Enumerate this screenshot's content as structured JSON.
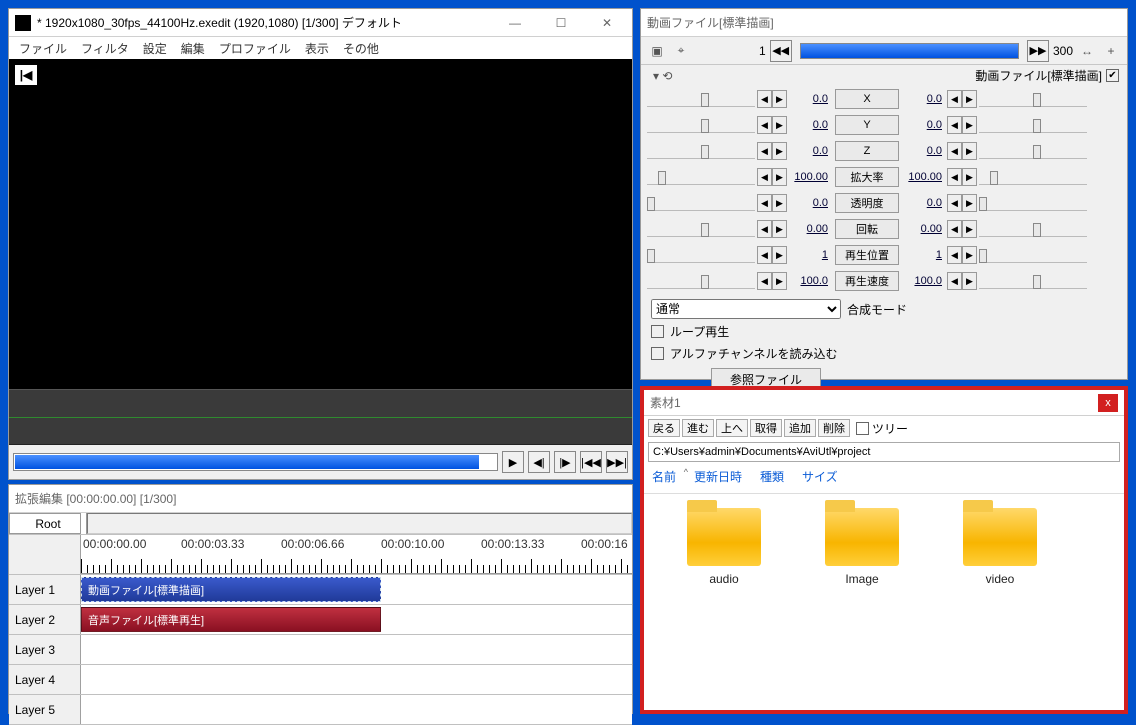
{
  "main": {
    "title": "* 1920x1080_30fps_44100Hz.exedit (1920,1080)  [1/300]  デフォルト",
    "menus": [
      "ファイル",
      "フィルタ",
      "設定",
      "編集",
      "プロファイル",
      "表示",
      "その他"
    ],
    "first_frame_icon": "|◀",
    "transport": [
      "▶",
      "◀|",
      "|▶",
      "|◀◀",
      "▶▶|"
    ]
  },
  "timeline": {
    "title": "拡張編集 [00:00:00.00] [1/300]",
    "root_label": "Root",
    "times": [
      "00:00:00.00",
      "00:00:03.33",
      "00:00:06.66",
      "00:00:10.00",
      "00:00:13.33",
      "00:00:16"
    ],
    "layers": [
      "Layer 1",
      "Layer 2",
      "Layer 3",
      "Layer 4",
      "Layer 5"
    ],
    "clip_video": "動画ファイル[標準描画]",
    "clip_audio": "音声ファイル[標準再生]"
  },
  "props": {
    "title": "動画ファイル[標準描画]",
    "frame_from": "1",
    "frame_to": "300",
    "subhead": "動画ファイル[標準描画]",
    "params": [
      {
        "l": "0.0",
        "name": "X",
        "r": "0.0",
        "lp": 50,
        "rp": 50
      },
      {
        "l": "0.0",
        "name": "Y",
        "r": "0.0",
        "lp": 50,
        "rp": 50
      },
      {
        "l": "0.0",
        "name": "Z",
        "r": "0.0",
        "lp": 50,
        "rp": 50
      },
      {
        "l": "100.00",
        "name": "拡大率",
        "r": "100.00",
        "lp": 10,
        "rp": 10
      },
      {
        "l": "0.0",
        "name": "透明度",
        "r": "0.0",
        "lp": 0,
        "rp": 0
      },
      {
        "l": "0.00",
        "name": "回転",
        "r": "0.00",
        "lp": 50,
        "rp": 50
      },
      {
        "l": "1",
        "name": "再生位置",
        "r": "1",
        "lp": 0,
        "rp": 0
      },
      {
        "l": "100.0",
        "name": "再生速度",
        "r": "100.0",
        "lp": 50,
        "rp": 50
      }
    ],
    "blend_label": "合成モード",
    "blend_value": "通常",
    "check_loop": "ループ再生",
    "check_alpha": "アルファチャンネルを読み込む",
    "ref_btn": "参照ファイル"
  },
  "browser": {
    "title": "素材1",
    "buttons": [
      "戻る",
      "進む",
      "上へ",
      "取得",
      "追加",
      "削除"
    ],
    "tree_chk": "ツリー",
    "path": "C:¥Users¥admin¥Documents¥AviUtl¥project",
    "cols": [
      "名前",
      "更新日時",
      "種類",
      "サイズ"
    ],
    "folders": [
      "audio",
      "Image",
      "video"
    ]
  }
}
